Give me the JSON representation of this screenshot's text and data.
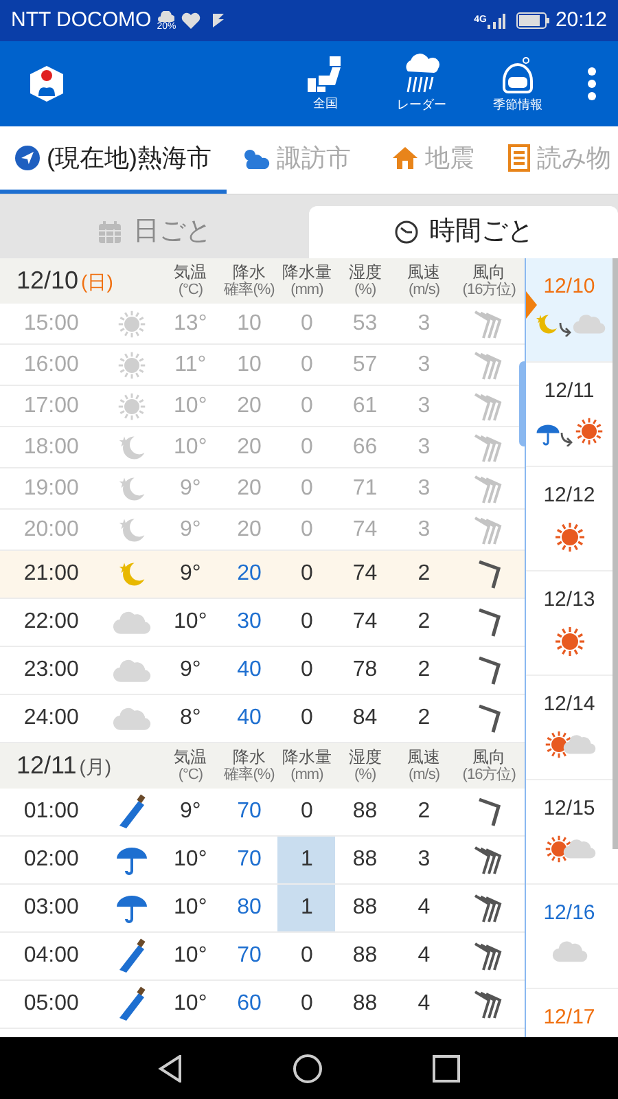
{
  "status_bar": {
    "carrier": "NTT DOCOMO",
    "rain_chance": "20%",
    "network": "4G",
    "time": "20:12"
  },
  "app_bar": {
    "actions": [
      {
        "kind": "map",
        "label": "全国"
      },
      {
        "kind": "radar",
        "label": "レーダー"
      },
      {
        "kind": "season",
        "label": "季節情報"
      }
    ]
  },
  "location_tabs": [
    {
      "kind": "here",
      "label": "(現在地)熱海市",
      "selected": true
    },
    {
      "kind": "weather",
      "label": "諏訪市",
      "selected": false
    },
    {
      "kind": "quake",
      "label": "地震",
      "selected": false
    },
    {
      "kind": "read",
      "label": "読み物",
      "selected": false
    }
  ],
  "view_tabs": [
    {
      "kind": "calendar",
      "label": "日ごと",
      "selected": false
    },
    {
      "kind": "clock",
      "label": "時間ごと",
      "selected": true
    }
  ],
  "sections": [
    {
      "date": "12/10",
      "weekday": {
        "text": "(日)",
        "color": "#f07010"
      },
      "columns": [
        {
          "label": "気温",
          "unit": "(°C)"
        },
        {
          "label": "降水",
          "unit": "確率(%)"
        },
        {
          "label": "降水量",
          "unit": "(mm)"
        },
        {
          "label": "湿度",
          "unit": "(%)"
        },
        {
          "label": "風速",
          "unit": "(m/s)"
        },
        {
          "label": "風向",
          "unit": "(16方位)"
        }
      ],
      "rows": [
        {
          "time": "15:00",
          "weather": {
            "kind": "sun"
          },
          "temp": "13°",
          "prob": "10",
          "amount": "0",
          "humidity": "53",
          "speed": "3",
          "wind": {
            "kind": "triple"
          },
          "past": true,
          "current": false,
          "rain": false
        },
        {
          "time": "16:00",
          "weather": {
            "kind": "sun"
          },
          "temp": "11°",
          "prob": "10",
          "amount": "0",
          "humidity": "57",
          "speed": "3",
          "wind": {
            "kind": "triple"
          },
          "past": true,
          "current": false,
          "rain": false
        },
        {
          "time": "17:00",
          "weather": {
            "kind": "sun"
          },
          "temp": "10°",
          "prob": "20",
          "amount": "0",
          "humidity": "61",
          "speed": "3",
          "wind": {
            "kind": "triple"
          },
          "past": true,
          "current": false,
          "rain": false
        },
        {
          "time": "18:00",
          "weather": {
            "kind": "moon"
          },
          "temp": "10°",
          "prob": "20",
          "amount": "0",
          "humidity": "66",
          "speed": "3",
          "wind": {
            "kind": "triple"
          },
          "past": true,
          "current": false,
          "rain": false
        },
        {
          "time": "19:00",
          "weather": {
            "kind": "moon"
          },
          "temp": "9°",
          "prob": "20",
          "amount": "0",
          "humidity": "71",
          "speed": "3",
          "wind": {
            "kind": "triple"
          },
          "past": true,
          "current": false,
          "rain": false
        },
        {
          "time": "20:00",
          "weather": {
            "kind": "moon"
          },
          "temp": "9°",
          "prob": "20",
          "amount": "0",
          "humidity": "74",
          "speed": "3",
          "wind": {
            "kind": "triple"
          },
          "past": true,
          "current": false,
          "rain": false
        },
        {
          "time": "21:00",
          "weather": {
            "kind": "moon"
          },
          "temp": "9°",
          "prob": "20",
          "amount": "0",
          "humidity": "74",
          "speed": "2",
          "wind": {
            "kind": "single"
          },
          "past": false,
          "current": true,
          "rain": false
        },
        {
          "time": "22:00",
          "weather": {
            "kind": "cloud"
          },
          "temp": "10°",
          "prob": "30",
          "amount": "0",
          "humidity": "74",
          "speed": "2",
          "wind": {
            "kind": "single"
          },
          "past": false,
          "current": false,
          "rain": false
        },
        {
          "time": "23:00",
          "weather": {
            "kind": "cloud"
          },
          "temp": "9°",
          "prob": "40",
          "amount": "0",
          "humidity": "78",
          "speed": "2",
          "wind": {
            "kind": "single"
          },
          "past": false,
          "current": false,
          "rain": false
        },
        {
          "time": "24:00",
          "weather": {
            "kind": "cloud"
          },
          "temp": "8°",
          "prob": "40",
          "amount": "0",
          "humidity": "84",
          "speed": "2",
          "wind": {
            "kind": "single"
          },
          "past": false,
          "current": false,
          "rain": false
        }
      ]
    },
    {
      "date": "12/11",
      "weekday": {
        "text": "(月)",
        "color": "#555555"
      },
      "columns": [
        {
          "label": "気温",
          "unit": "(°C)"
        },
        {
          "label": "降水",
          "unit": "確率(%)"
        },
        {
          "label": "降水量",
          "unit": "(mm)"
        },
        {
          "label": "湿度",
          "unit": "(%)"
        },
        {
          "label": "風速",
          "unit": "(m/s)"
        },
        {
          "label": "風向",
          "unit": "(16方位)"
        }
      ],
      "rows": [
        {
          "time": "01:00",
          "weather": {
            "kind": "umbrella-closed"
          },
          "temp": "9°",
          "prob": "70",
          "amount": "0",
          "humidity": "88",
          "speed": "2",
          "wind": {
            "kind": "single"
          },
          "past": false,
          "current": false,
          "rain": false
        },
        {
          "time": "02:00",
          "weather": {
            "kind": "umbrella"
          },
          "temp": "10°",
          "prob": "70",
          "amount": "1",
          "humidity": "88",
          "speed": "3",
          "wind": {
            "kind": "triple"
          },
          "past": false,
          "current": false,
          "rain": true
        },
        {
          "time": "03:00",
          "weather": {
            "kind": "umbrella"
          },
          "temp": "10°",
          "prob": "80",
          "amount": "1",
          "humidity": "88",
          "speed": "4",
          "wind": {
            "kind": "triple"
          },
          "past": false,
          "current": false,
          "rain": true
        },
        {
          "time": "04:00",
          "weather": {
            "kind": "umbrella-closed"
          },
          "temp": "10°",
          "prob": "70",
          "amount": "0",
          "humidity": "88",
          "speed": "4",
          "wind": {
            "kind": "triple"
          },
          "past": false,
          "current": false,
          "rain": false
        },
        {
          "time": "05:00",
          "weather": {
            "kind": "umbrella-closed"
          },
          "temp": "10°",
          "prob": "60",
          "amount": "0",
          "humidity": "88",
          "speed": "4",
          "wind": {
            "kind": "triple"
          },
          "past": false,
          "current": false,
          "rain": false
        }
      ]
    }
  ],
  "days": [
    {
      "date": "12/10",
      "color": "#f07010",
      "selected": true,
      "weather": {
        "kind": "change",
        "icons": [
          {
            "kind": "moon"
          },
          {
            "kind": "cloud"
          }
        ]
      }
    },
    {
      "date": "12/11",
      "color": "#333333",
      "selected": false,
      "weather": {
        "kind": "change",
        "icons": [
          {
            "kind": "umbrella"
          },
          {
            "kind": "sun"
          }
        ]
      }
    },
    {
      "date": "12/12",
      "color": "#333333",
      "selected": false,
      "weather": {
        "kind": "single",
        "icons": [
          {
            "kind": "sun"
          }
        ]
      }
    },
    {
      "date": "12/13",
      "color": "#333333",
      "selected": false,
      "weather": {
        "kind": "single",
        "icons": [
          {
            "kind": "sun"
          }
        ]
      }
    },
    {
      "date": "12/14",
      "color": "#333333",
      "selected": false,
      "weather": {
        "kind": "sometimes",
        "icons": [
          {
            "kind": "sun"
          },
          {
            "kind": "cloud"
          }
        ]
      }
    },
    {
      "date": "12/15",
      "color": "#333333",
      "selected": false,
      "weather": {
        "kind": "sometimes",
        "icons": [
          {
            "kind": "sun"
          },
          {
            "kind": "cloud"
          }
        ]
      }
    },
    {
      "date": "12/16",
      "color": "#1e6fd0",
      "selected": false,
      "weather": {
        "kind": "single",
        "icons": [
          {
            "kind": "cloud"
          }
        ]
      }
    },
    {
      "date": "12/17",
      "color": "#f07010",
      "selected": false
    }
  ]
}
